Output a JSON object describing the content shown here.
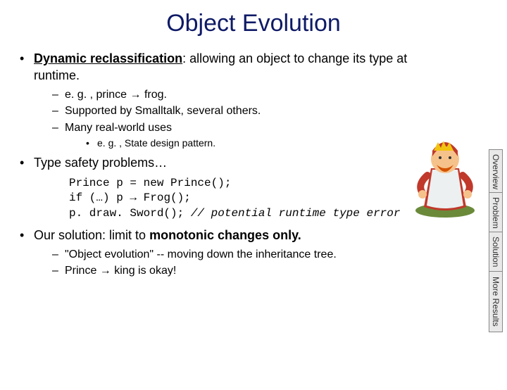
{
  "title": "Object Evolution",
  "bullets": {
    "b1_strong": "Dynamic reclassification",
    "b1_rest": ": allowing an object to change its type at runtime.",
    "b1_sub1_pre": "e. g. , prince ",
    "b1_sub1_post": " frog.",
    "b1_sub2": "Supported by Smalltalk, several others.",
    "b1_sub3": "Many real-world uses",
    "b1_sub3_sub": "e. g. , State design pattern.",
    "b2": "Type safety problems…",
    "b3_pre": "Our solution: limit to ",
    "b3_strong": "monotonic changes only.",
    "b3_sub1": "\"Object evolution\" -- moving down the inheritance tree.",
    "b3_sub2_pre": "Prince ",
    "b3_sub2_post": " king is okay!"
  },
  "code": {
    "l1": "Prince p = new Prince();",
    "l2_pre": "if (…) p ",
    "l2_post": " Frog();",
    "l3_code": "p. draw. Sword(); ",
    "l3_comment": "// potential runtime type error"
  },
  "arrow": "→",
  "tabs": [
    "Overview",
    "Problem",
    "Solution",
    "More Results"
  ]
}
